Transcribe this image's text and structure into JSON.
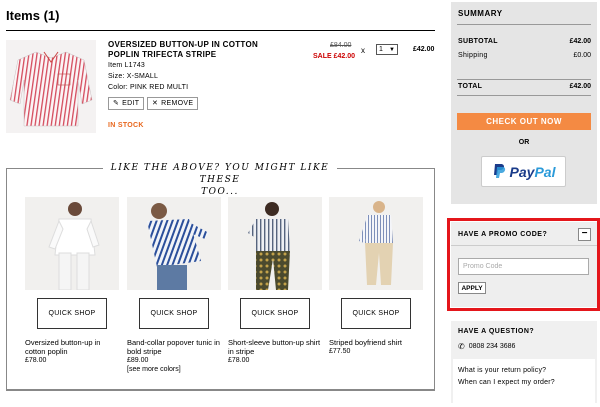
{
  "cart": {
    "title": "Items (1)",
    "item": {
      "name_line1": "OVERSIZED BUTTON-UP IN COTTON",
      "name_line2": "POPLIN TRIFECTA STRIPE",
      "item_no": "Item L1743",
      "size": "Size: X-SMALL",
      "color": "Color: PINK RED MULTI",
      "edit_label": "EDIT",
      "remove_label": "REMOVE",
      "stock": "IN STOCK",
      "price_original": "£84.00",
      "price_sale": "SALE £42.00",
      "times": "x",
      "quantity": "1",
      "total": "£42.00"
    }
  },
  "recommendations": {
    "heading_line1": "LIKE THE ABOVE? YOU MIGHT LIKE THESE",
    "heading_line2": "TOO...",
    "quick_shop_label": "QUICK SHOP",
    "items": [
      {
        "name": "Oversized button-up in cotton poplin",
        "price": "£78.00",
        "extra": ""
      },
      {
        "name": "Band-collar popover tunic in bold stripe",
        "price": "£89.00",
        "extra": "[see more colors]"
      },
      {
        "name": "Short-sleeve button-up shirt in stripe",
        "price": "£78.00",
        "extra": ""
      },
      {
        "name": "Striped boyfriend shirt",
        "price": "£77.50",
        "extra": ""
      }
    ]
  },
  "summary": {
    "title": "SUMMARY",
    "subtotal_label": "SUBTOTAL",
    "subtotal_value": "£42.00",
    "shipping_label": "Shipping",
    "shipping_value": "£0.00",
    "total_label": "TOTAL",
    "total_value": "£42.00",
    "checkout_label": "CHECK OUT NOW",
    "or_label": "OR",
    "paypal_a": "Pay",
    "paypal_b": "Pal"
  },
  "promo": {
    "title": "HAVE A PROMO CODE?",
    "toggle": "−",
    "placeholder": "Promo Code",
    "apply_label": "APPLY"
  },
  "help": {
    "title": "HAVE A QUESTION?",
    "phone": "0808 234 3686",
    "link_return": "What is your return policy?",
    "link_order": "When can I expect my order?"
  },
  "colors": {
    "accent_orange": "#f48a43",
    "sale_red": "#cc0000",
    "highlight_red": "#e4161b",
    "paypal_dark": "#1a3b8a",
    "paypal_light": "#2a9ad9"
  }
}
